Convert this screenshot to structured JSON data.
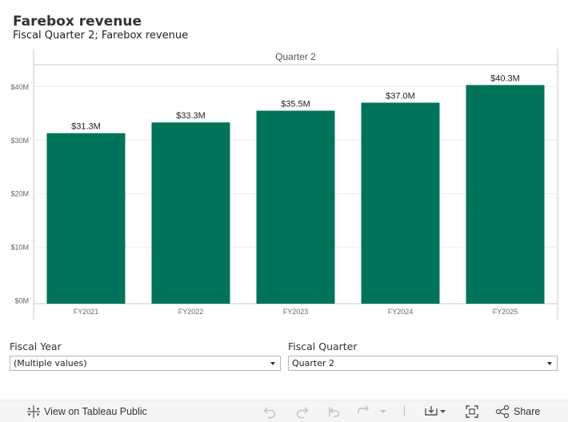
{
  "header": {
    "title": "Farebox revenue",
    "subtitle": "Fiscal Quarter 2;  Farebox revenue"
  },
  "chart_data": {
    "type": "bar",
    "panel_header": "Quarter 2",
    "categories": [
      "FY2021",
      "FY2022",
      "FY2023",
      "FY2024",
      "FY2025"
    ],
    "values": [
      31.3,
      33.3,
      35.5,
      37.0,
      40.3
    ],
    "data_labels": [
      "$31.3M",
      "$33.3M",
      "$35.5M",
      "$37.0M",
      "$40.3M"
    ],
    "y_ticks": [
      0,
      10,
      20,
      30,
      40
    ],
    "y_tick_labels": [
      "$0M",
      "$10M",
      "$20M",
      "$30M",
      "$40M"
    ],
    "ylim": [
      0,
      43
    ],
    "bar_color": "#00735a",
    "gridlines": true
  },
  "filters": [
    {
      "label": "Fiscal Year",
      "value": "(Multiple values)"
    },
    {
      "label": "Fiscal Quarter",
      "value": "Quarter 2"
    }
  ],
  "toolbar": {
    "view_label": "View on Tableau Public",
    "share_label": "Share",
    "icons": [
      "tableau-logo-icon",
      "undo-icon",
      "redo-icon",
      "revert-icon",
      "refresh-icon",
      "pause-icon",
      "download-icon",
      "fullscreen-icon",
      "share-icon"
    ]
  }
}
